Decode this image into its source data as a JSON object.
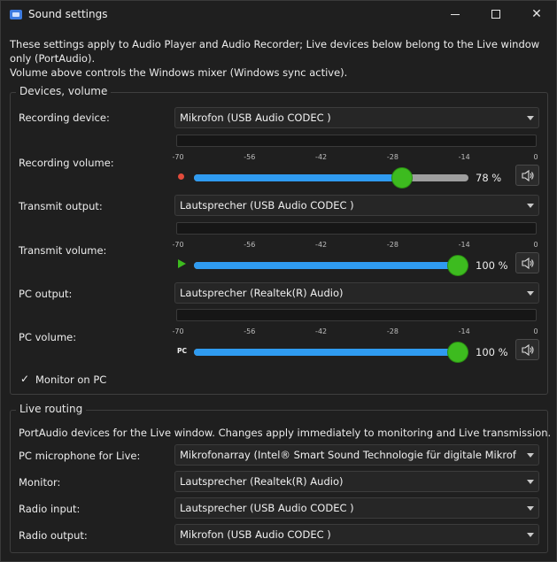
{
  "window": {
    "title": "Sound settings",
    "minimize_glyph": "",
    "close_glyph": "✕"
  },
  "intro": {
    "line1": "These settings apply to Audio Player and Audio Recorder; Live devices below belong to the Live window only (PortAudio).",
    "line2": "Volume above controls the Windows mixer (Windows sync active)."
  },
  "devices": {
    "group_title": "Devices, volume",
    "recording_device_label": "Recording device:",
    "recording_device_value": "Mikrofon (USB Audio CODEC )",
    "recording_volume_label": "Recording volume:",
    "recording_volume_pct": "78 %",
    "recording_volume_level": 0.78,
    "transmit_output_label": "Transmit output:",
    "transmit_output_value": "Lautsprecher (USB Audio CODEC )",
    "transmit_volume_label": "Transmit volume:",
    "transmit_volume_pct": "100 %",
    "transmit_volume_level": 1.0,
    "pc_output_label": "PC output:",
    "pc_output_value": "Lautsprecher (Realtek(R) Audio)",
    "pc_volume_label": "PC volume:",
    "pc_volume_pct": "100 %",
    "pc_volume_level": 1.0,
    "pc_tag": "PC",
    "monitor_check_glyph": "✓",
    "monitor_label": "Monitor on PC",
    "meter_ticks": [
      "-70",
      "-56",
      "-42",
      "-28",
      "-14",
      "0"
    ]
  },
  "live": {
    "group_title": "Live routing",
    "description": "PortAudio devices for the Live window. Changes apply immediately to monitoring and Live transmission.",
    "pc_mic_label": "PC microphone for Live:",
    "pc_mic_value": "Mikrofonarray (Intel® Smart Sound Technologie für digitale Mikrofone)",
    "monitor_label": "Monitor:",
    "monitor_value": "Lautsprecher (Realtek(R) Audio)",
    "radio_input_label": "Radio input:",
    "radio_input_value": "Lautsprecher (USB Audio CODEC )",
    "radio_output_label": "Radio output:",
    "radio_output_value": "Mikrofon (USB Audio CODEC )"
  },
  "icons": {
    "app": "audio-device-icon",
    "mute": "speaker-icon"
  },
  "colors": {
    "accent": "#2f9bf0",
    "thumb": "#3dbb1f",
    "record": "#e24b3b",
    "background": "#1f1f1f"
  }
}
